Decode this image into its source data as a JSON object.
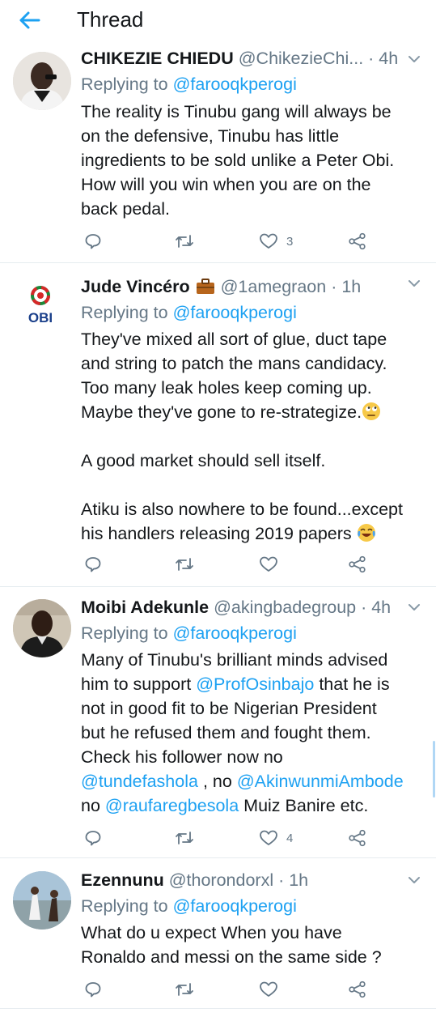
{
  "header": {
    "title": "Thread"
  },
  "tweets": [
    {
      "name": "CHIKEZIE CHIEDU",
      "handle": "@ChikezieChi...",
      "time": "· 4h",
      "replying_prefix": "Replying to",
      "replying_to": "@farooqkperogi",
      "lines": [
        "The reality is Tinubu gang will always be",
        "on the defensive, Tinubu has little",
        "ingredients to be sold unlike a Peter Obi.",
        "How will you win when you are on the",
        "back pedal."
      ],
      "likes": "3"
    },
    {
      "name": "Jude Vincéro",
      "handle": "@1amegraon",
      "time": "· 1h",
      "avatar_text": "OBI",
      "replying_prefix": "Replying to",
      "replying_to": "@farooqkperogi",
      "lines": [
        "They've mixed all sort of glue, duct tape",
        "and string to patch the mans candidacy.",
        "Too many leak holes keep coming up.",
        "Maybe they've gone to re-strategize.",
        "A good market should sell itself.",
        "Atiku is also nowhere to be found...except",
        "his handlers releasing 2019 papers"
      ],
      "likes": ""
    },
    {
      "name": "Moibi Adekunle",
      "handle": "@akingbadegroup",
      "time": "· 4h",
      "replying_prefix": "Replying to",
      "replying_to": "@farooqkperogi",
      "lines": [
        "Many of Tinubu's brilliant minds advised",
        "him to support",
        "that he is",
        "not in good fit to be Nigerian President",
        "but he refused them and fought them.",
        "Check his follower now no",
        ", no",
        "no",
        "Muiz Banire etc."
      ],
      "mentions": [
        "@ProfOsinbajo",
        "@tundefashola",
        "@AkinwunmiAmbode",
        "@raufaregbesola"
      ],
      "likes": "4"
    },
    {
      "name": "Ezennunu",
      "handle": "@thorondorxl",
      "time": "· 1h",
      "replying_prefix": "Replying to",
      "replying_to": "@farooqkperogi",
      "lines": [
        "What do u expect When you have",
        "Ronaldo and messi on the same side ?"
      ],
      "likes": ""
    }
  ],
  "colors": {
    "accent": "#1da1f2",
    "muted": "#657786",
    "text": "#14171a",
    "divider": "#e6ecf0"
  },
  "icons": [
    "back-arrow-icon",
    "chevron-down-icon",
    "reply-icon",
    "retweet-icon",
    "like-icon",
    "share-icon"
  ]
}
